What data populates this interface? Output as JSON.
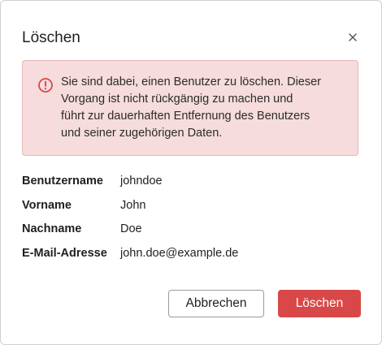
{
  "dialog": {
    "title": "Löschen",
    "close_icon": "close-icon"
  },
  "alert": {
    "icon": "error-circle-icon",
    "lines": [
      "Sie sind dabei, einen Benutzer zu löschen. Dieser",
      "Vorgang ist nicht rückgängig zu machen und",
      "führt zur dauerhaften Entfernung des Benutzers",
      "und seiner zugehörigen Daten."
    ]
  },
  "details": [
    {
      "label": "Benutzername",
      "value": "johndoe"
    },
    {
      "label": "Vorname",
      "value": "John"
    },
    {
      "label": "Nachname",
      "value": "Doe"
    },
    {
      "label": "E-Mail-Adresse",
      "value": "john.doe@example.de"
    }
  ],
  "buttons": {
    "cancel_label": "Abbrechen",
    "delete_label": "Löschen"
  },
  "colors": {
    "danger": "#d94848",
    "alert_bg": "#f6dcdc",
    "alert_border": "#eab6b6"
  }
}
